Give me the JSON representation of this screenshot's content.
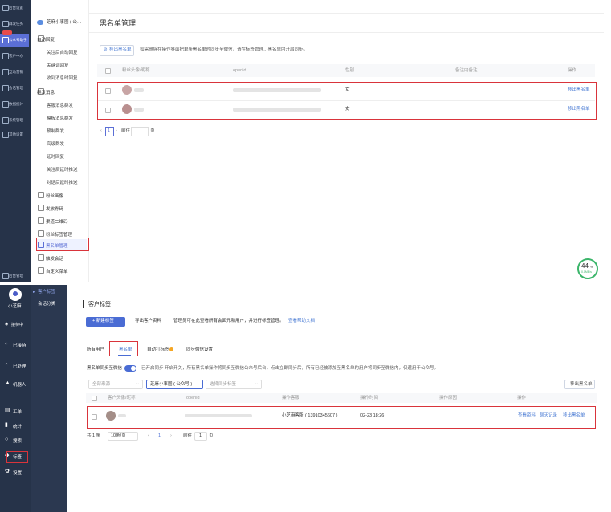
{
  "top": {
    "left_nav": [
      "后台设置",
      "群发任务",
      "公众号助手",
      "客户中心",
      "互动营销",
      "会话管理",
      "数据统计",
      "系统管理",
      "其他设置",
      "后台管理"
    ],
    "account_name": "芝麻小事圈 ( 公…",
    "menu": {
      "auto_reply": {
        "title": "自动回复",
        "items": [
          "关注后自动回复",
          "关键词回复",
          "收到消息时回复"
        ]
      },
      "mass": {
        "title": "群发消息",
        "items": [
          "客服消息群发",
          "模板消息群发",
          "预制群发",
          "高级群发",
          "延时回复",
          "关注后延时推送",
          "对话后延时推送"
        ]
      },
      "others": [
        "粉丝画像",
        "发放券码",
        "渠道二维码",
        "粉丝标签管理",
        "黑名单管理",
        "触发会话",
        "自定义菜单"
      ]
    },
    "page_title": "黑名单管理",
    "remove_button": "移出黑名单",
    "notice": "如需删除在操作界面把单条黑名单时同步至微信，请在标签管理…黑名单内开启同步。",
    "columns": [
      "粉丝头像/昵称",
      "openid",
      "性别",
      "备注内备注",
      "操作"
    ],
    "rows": [
      {
        "gender": "女",
        "action": "移出黑名单"
      },
      {
        "gender": "女",
        "action": "移出黑名单"
      }
    ],
    "pagination": {
      "page": "1",
      "goto_label": "前往",
      "suffix": "页"
    },
    "progress": {
      "value": "44",
      "unit": "%",
      "sub": "0.1MB/s"
    }
  },
  "bottom": {
    "nav_top": "客户标签",
    "nav_sub": "会话分类",
    "user_name": "小芝麻",
    "status": "接待中",
    "left_nav": [
      "接待中",
      "已接待",
      "已处理",
      "机器人",
      "工单",
      "统计",
      "搜索",
      "标签",
      "设置"
    ],
    "page_title": "客户标签",
    "new_tag_button": "+ 新建标签",
    "export_link": "导出客户资料",
    "desc": "管理员可在此查看所有会面元和用户，并进行标签管理。",
    "help_link": "查看帮助文档",
    "tabs": [
      "所有用户",
      "黑名单",
      "自动打标签",
      "同步微信设置"
    ],
    "sync_label": "黑名单同步至微信",
    "sync_desc": "已开启同步 开启开关，所有黑名单操作将同步至微信公众号后台，点击立即同步后，所有已经被添加至黑名单的用户将同步至微信内，仅适用于公众号。",
    "filter1": "全部来源",
    "filter2": "芝麻小事圈 ( 公众号 )",
    "filter3": "选择同步标签",
    "remove_button": "移出黑名单",
    "columns": [
      "客户头像/昵称",
      "openid",
      "操作客服",
      "操作时间",
      "操作原因",
      "操作"
    ],
    "row": {
      "agent": "小芝麻客服 ( 13910345607 )",
      "time": "02-23 18:26",
      "actions": [
        "查看资料",
        "聊天记录",
        "移出黑名单"
      ]
    },
    "pagination": {
      "total": "共 1 条",
      "page_size": "10条/页",
      "page": "1",
      "goto_label": "前往",
      "goto_value": "1",
      "suffix": "页"
    }
  }
}
